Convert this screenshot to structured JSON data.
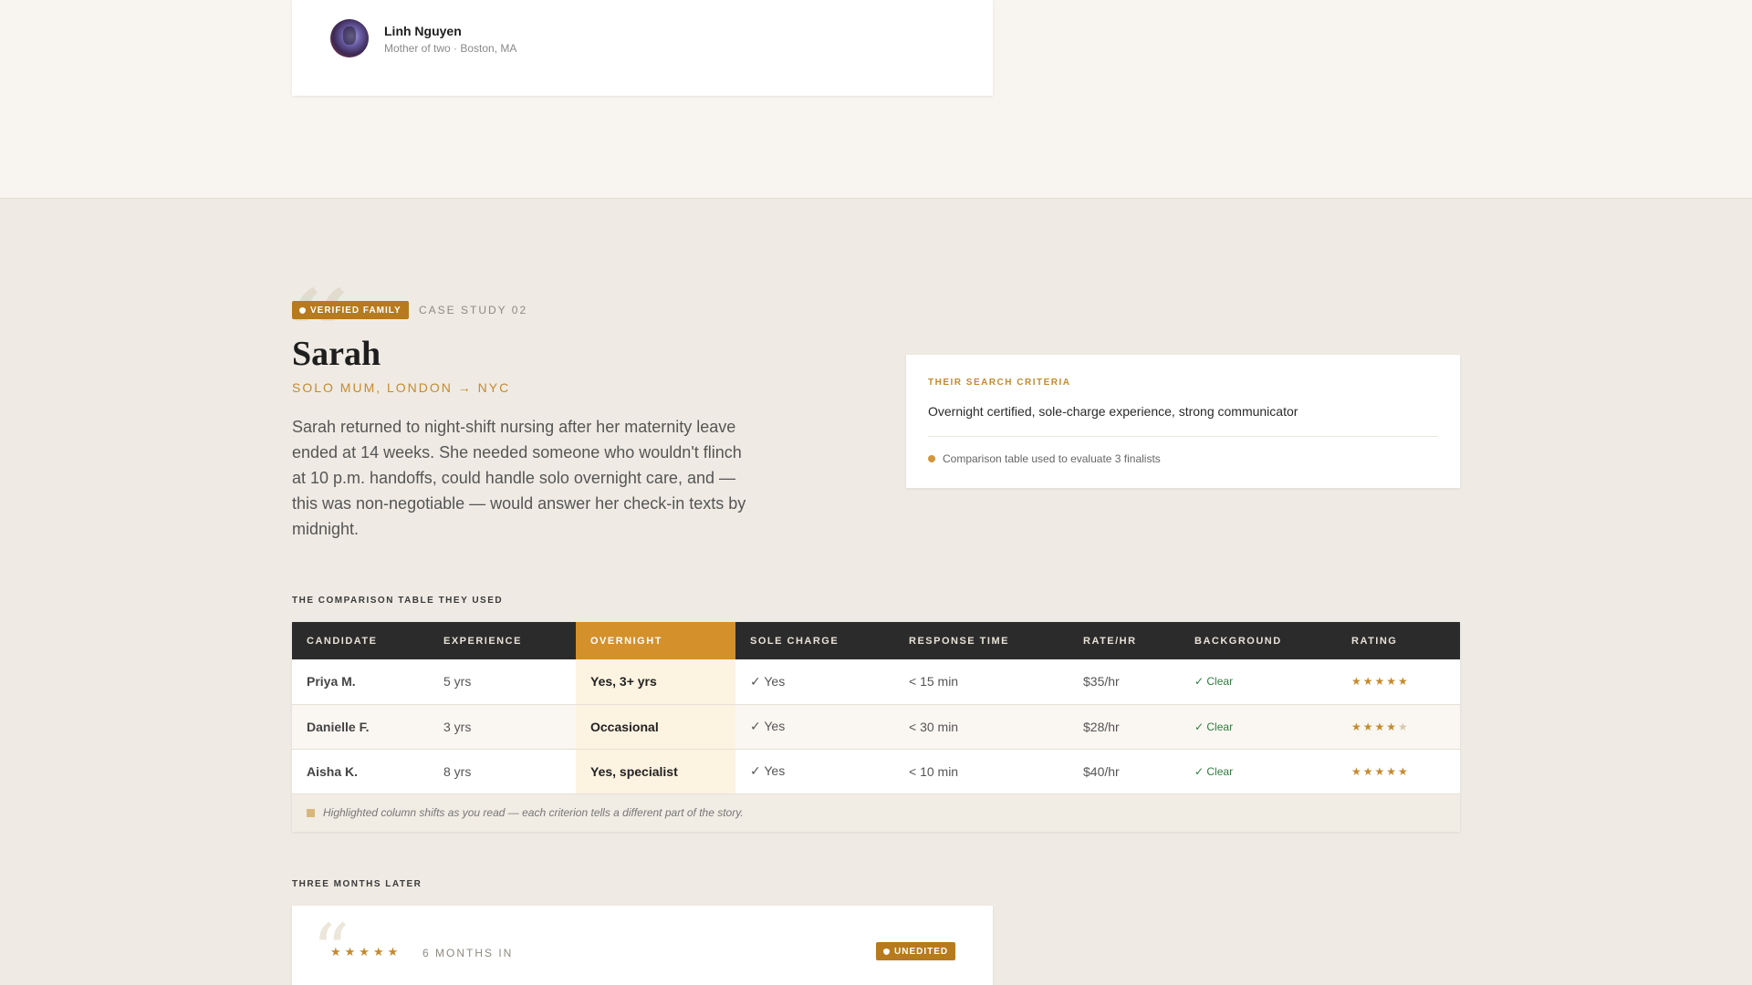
{
  "top_card": {
    "name": "Linh Nguyen",
    "subtitle": "Mother of two · Boston, MA"
  },
  "case": {
    "badge": "VERIFIED FAMILY",
    "label": "CASE STUDY 02",
    "name": "Sarah",
    "subtitle": "SOLO MUM, LONDON → NYC",
    "story": "Sarah returned to night-shift nursing after her maternity leave ended at 14 weeks. She needed someone who wouldn't flinch at 10 p.m. handoffs, could handle solo overnight care, and — this was non-negotiable — would answer her check-in texts by midnight."
  },
  "criteria": {
    "title": "THEIR SEARCH CRITERIA",
    "text": "Overnight certified, sole-charge experience, strong communicator",
    "note": "Comparison table used to evaluate 3 finalists"
  },
  "comparison": {
    "label": "THE COMPARISON TABLE THEY USED",
    "headers": [
      "CANDIDATE",
      "EXPERIENCE",
      "OVERNIGHT",
      "SOLE CHARGE",
      "RESPONSE TIME",
      "RATE/HR",
      "BACKGROUND",
      "RATING"
    ],
    "rows": [
      {
        "candidate": "Priya M.",
        "experience": "5 yrs",
        "overnight": "Yes, 3+ yrs",
        "sole_charge": "✓ Yes",
        "response": "< 15 min",
        "rate": "$35/hr",
        "background": "✓ Clear",
        "rating_stars": "★★★★★",
        "rating_empty": "",
        "rating": 5
      },
      {
        "candidate": "Danielle F.",
        "experience": "3 yrs",
        "overnight": "Occasional",
        "sole_charge": "✓ Yes",
        "response": "< 30 min",
        "rate": "$28/hr",
        "background": "✓ Clear",
        "rating_stars": "★★★★",
        "rating_empty": "★",
        "rating": 4
      },
      {
        "candidate": "Aisha K.",
        "experience": "8 yrs",
        "overnight": "Yes, specialist",
        "sole_charge": "✓ Yes",
        "response": "< 10 min",
        "rate": "$40/hr",
        "background": "✓ Clear",
        "rating_stars": "★★★★★",
        "rating_empty": "",
        "rating": 5
      }
    ],
    "footnote": "Highlighted column shifts as you read — each criterion tells a different part of the story."
  },
  "later": {
    "label": "THREE MONTHS LATER",
    "stars": "★★★★★",
    "rating": 5,
    "months": "6 MONTHS IN",
    "badge": "UNEDITED"
  },
  "colors": {
    "accent": "#c58a2e",
    "badge": "#b77a1c",
    "header_dark": "#2b2b2b",
    "highlight_column": "#d4902a",
    "clear_green": "#2e7d3e"
  }
}
